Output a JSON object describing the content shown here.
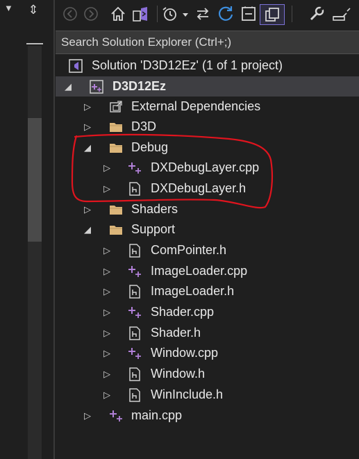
{
  "toolbar": {
    "buttons": [
      {
        "name": "back-button",
        "icon": "back-arrow-icon"
      },
      {
        "name": "forward-button",
        "icon": "forward-arrow-icon"
      },
      {
        "name": "home-button",
        "icon": "home-icon"
      },
      {
        "name": "switch-views-button",
        "icon": "vs-switch-views-icon"
      },
      {
        "name": "pending-changes-filter-button",
        "icon": "clock-icon"
      },
      {
        "name": "sync-with-active-document-button",
        "icon": "sync-arrows-icon"
      },
      {
        "name": "refresh-button",
        "icon": "refresh-icon"
      },
      {
        "name": "collapse-all-button",
        "icon": "collapse-all-icon"
      },
      {
        "name": "show-all-files-button",
        "icon": "show-all-files-icon"
      },
      {
        "name": "properties-button",
        "icon": "wrench-icon"
      },
      {
        "name": "preview-selected-button",
        "icon": "preview-icon"
      }
    ]
  },
  "search": {
    "placeholder": "Search Solution Explorer (Ctrl+;)"
  },
  "tree": {
    "solution": "Solution 'D3D12Ez' (1 of 1 project)",
    "project": "D3D12Ez",
    "items": [
      {
        "label": "External Dependencies",
        "type": "external",
        "expanded": false
      },
      {
        "label": "D3D",
        "type": "folder",
        "expanded": false
      },
      {
        "label": "Debug",
        "type": "folder",
        "expanded": true
      },
      {
        "label": "DXDebugLayer.cpp",
        "type": "cpp"
      },
      {
        "label": "DXDebugLayer.h",
        "type": "h"
      },
      {
        "label": "Shaders",
        "type": "folder",
        "expanded": false
      },
      {
        "label": "Support",
        "type": "folder",
        "expanded": true
      },
      {
        "label": "ComPointer.h",
        "type": "h"
      },
      {
        "label": "ImageLoader.cpp",
        "type": "cpp"
      },
      {
        "label": "ImageLoader.h",
        "type": "h"
      },
      {
        "label": "Shader.cpp",
        "type": "cpp"
      },
      {
        "label": "Shader.h",
        "type": "h"
      },
      {
        "label": "Window.cpp",
        "type": "cpp"
      },
      {
        "label": "Window.h",
        "type": "h"
      },
      {
        "label": "WinInclude.h",
        "type": "h"
      },
      {
        "label": "main.cpp",
        "type": "cpp"
      }
    ]
  },
  "colors": {
    "background": "#1f1f1f",
    "selection": "#3e3e42",
    "accent": "#7b72d6",
    "annotation": "#e0141e",
    "folder": "#dcb67a",
    "cpp_plus": "#b180d7"
  }
}
